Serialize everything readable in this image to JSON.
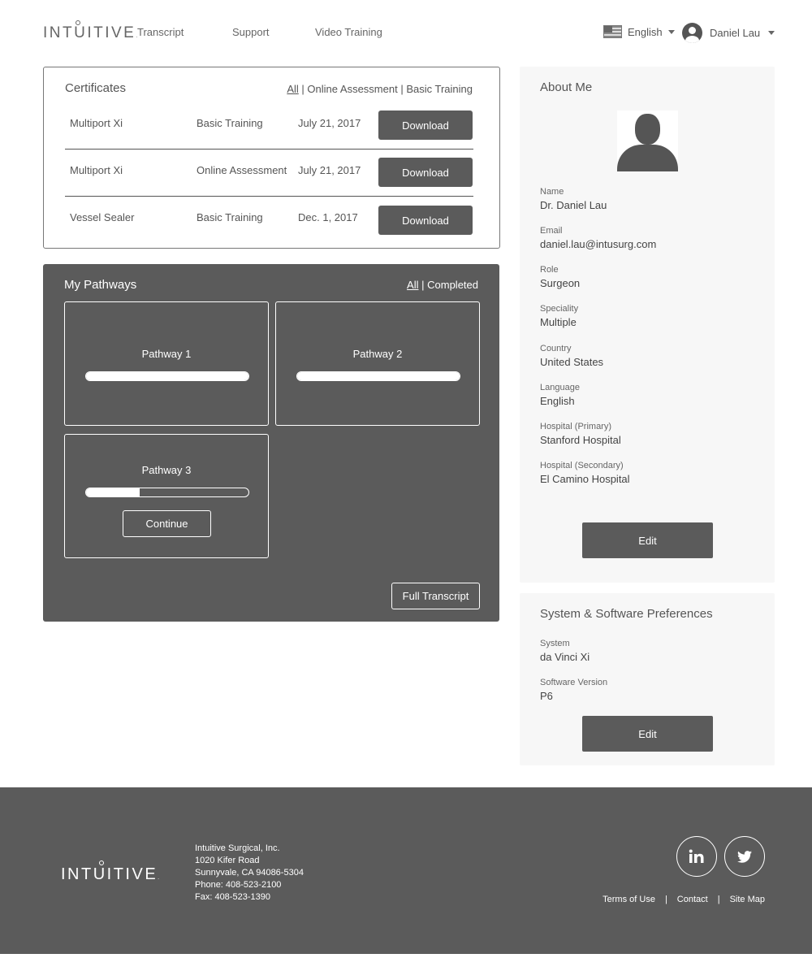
{
  "header": {
    "logo": "INTUITIVE",
    "nav": [
      "Transcript",
      "Support",
      "Video Training"
    ],
    "language": "English",
    "user": "Daniel Lau"
  },
  "certificates": {
    "title": "Certificates",
    "filters": {
      "all": "All",
      "separator": "|",
      "online": "Online Assessment",
      "basic": "Basic Training"
    },
    "rows": [
      {
        "product": "Multiport Xi",
        "type": "Basic Training",
        "date": "July 21, 2017",
        "button": "Download"
      },
      {
        "product": "Multiport Xi",
        "type": "Online Assessment",
        "date": "July 21, 2017",
        "button": "Download"
      },
      {
        "product": "Vessel Sealer",
        "type": "Basic Training",
        "date": "Dec. 1, 2017",
        "button": "Download"
      }
    ]
  },
  "pathways": {
    "title": "My Pathways",
    "filters": {
      "all": "All",
      "separator": "|",
      "completed": "Completed"
    },
    "items": [
      {
        "name": "Pathway 1",
        "progress": 1.0
      },
      {
        "name": "Pathway 2",
        "progress": 1.0
      },
      {
        "name": "Pathway 3",
        "progress": 0.33,
        "button": "Continue"
      }
    ],
    "transcript_button": "Full Transcript"
  },
  "about": {
    "title": "About Me",
    "fields": [
      {
        "label": "Name",
        "value": "Dr. Daniel Lau"
      },
      {
        "label": "Email",
        "value": "daniel.lau@intusurg.com"
      },
      {
        "label": "Role",
        "value": "Surgeon"
      },
      {
        "label": "Speciality",
        "value": "Multiple"
      },
      {
        "label": "Country",
        "value": "United States"
      },
      {
        "label": "Language",
        "value": "English"
      },
      {
        "label": "Hospital (Primary)",
        "value": "Stanford Hospital"
      },
      {
        "label": "Hospital (Secondary)",
        "value": "El Camino Hospital"
      }
    ],
    "edit": "Edit"
  },
  "preferences": {
    "title": "System & Software Preferences",
    "fields": [
      {
        "label": "System",
        "value": "da Vinci Xi"
      },
      {
        "label": "Software Version",
        "value": "P6"
      }
    ],
    "edit": "Edit"
  },
  "footer": {
    "logo": "INTUITIVE",
    "address": [
      "Intuitive Surgical, Inc.",
      "1020 Kifer Road",
      "Sunnyvale, CA 94086-5304",
      "Phone: 408-523-2100",
      "Fax: 408-523-1390"
    ],
    "social": [
      "linkedin-icon",
      "twitter-icon"
    ],
    "links": [
      "Terms of Use",
      "Contact",
      "Site Map"
    ],
    "link_separator": "|"
  }
}
